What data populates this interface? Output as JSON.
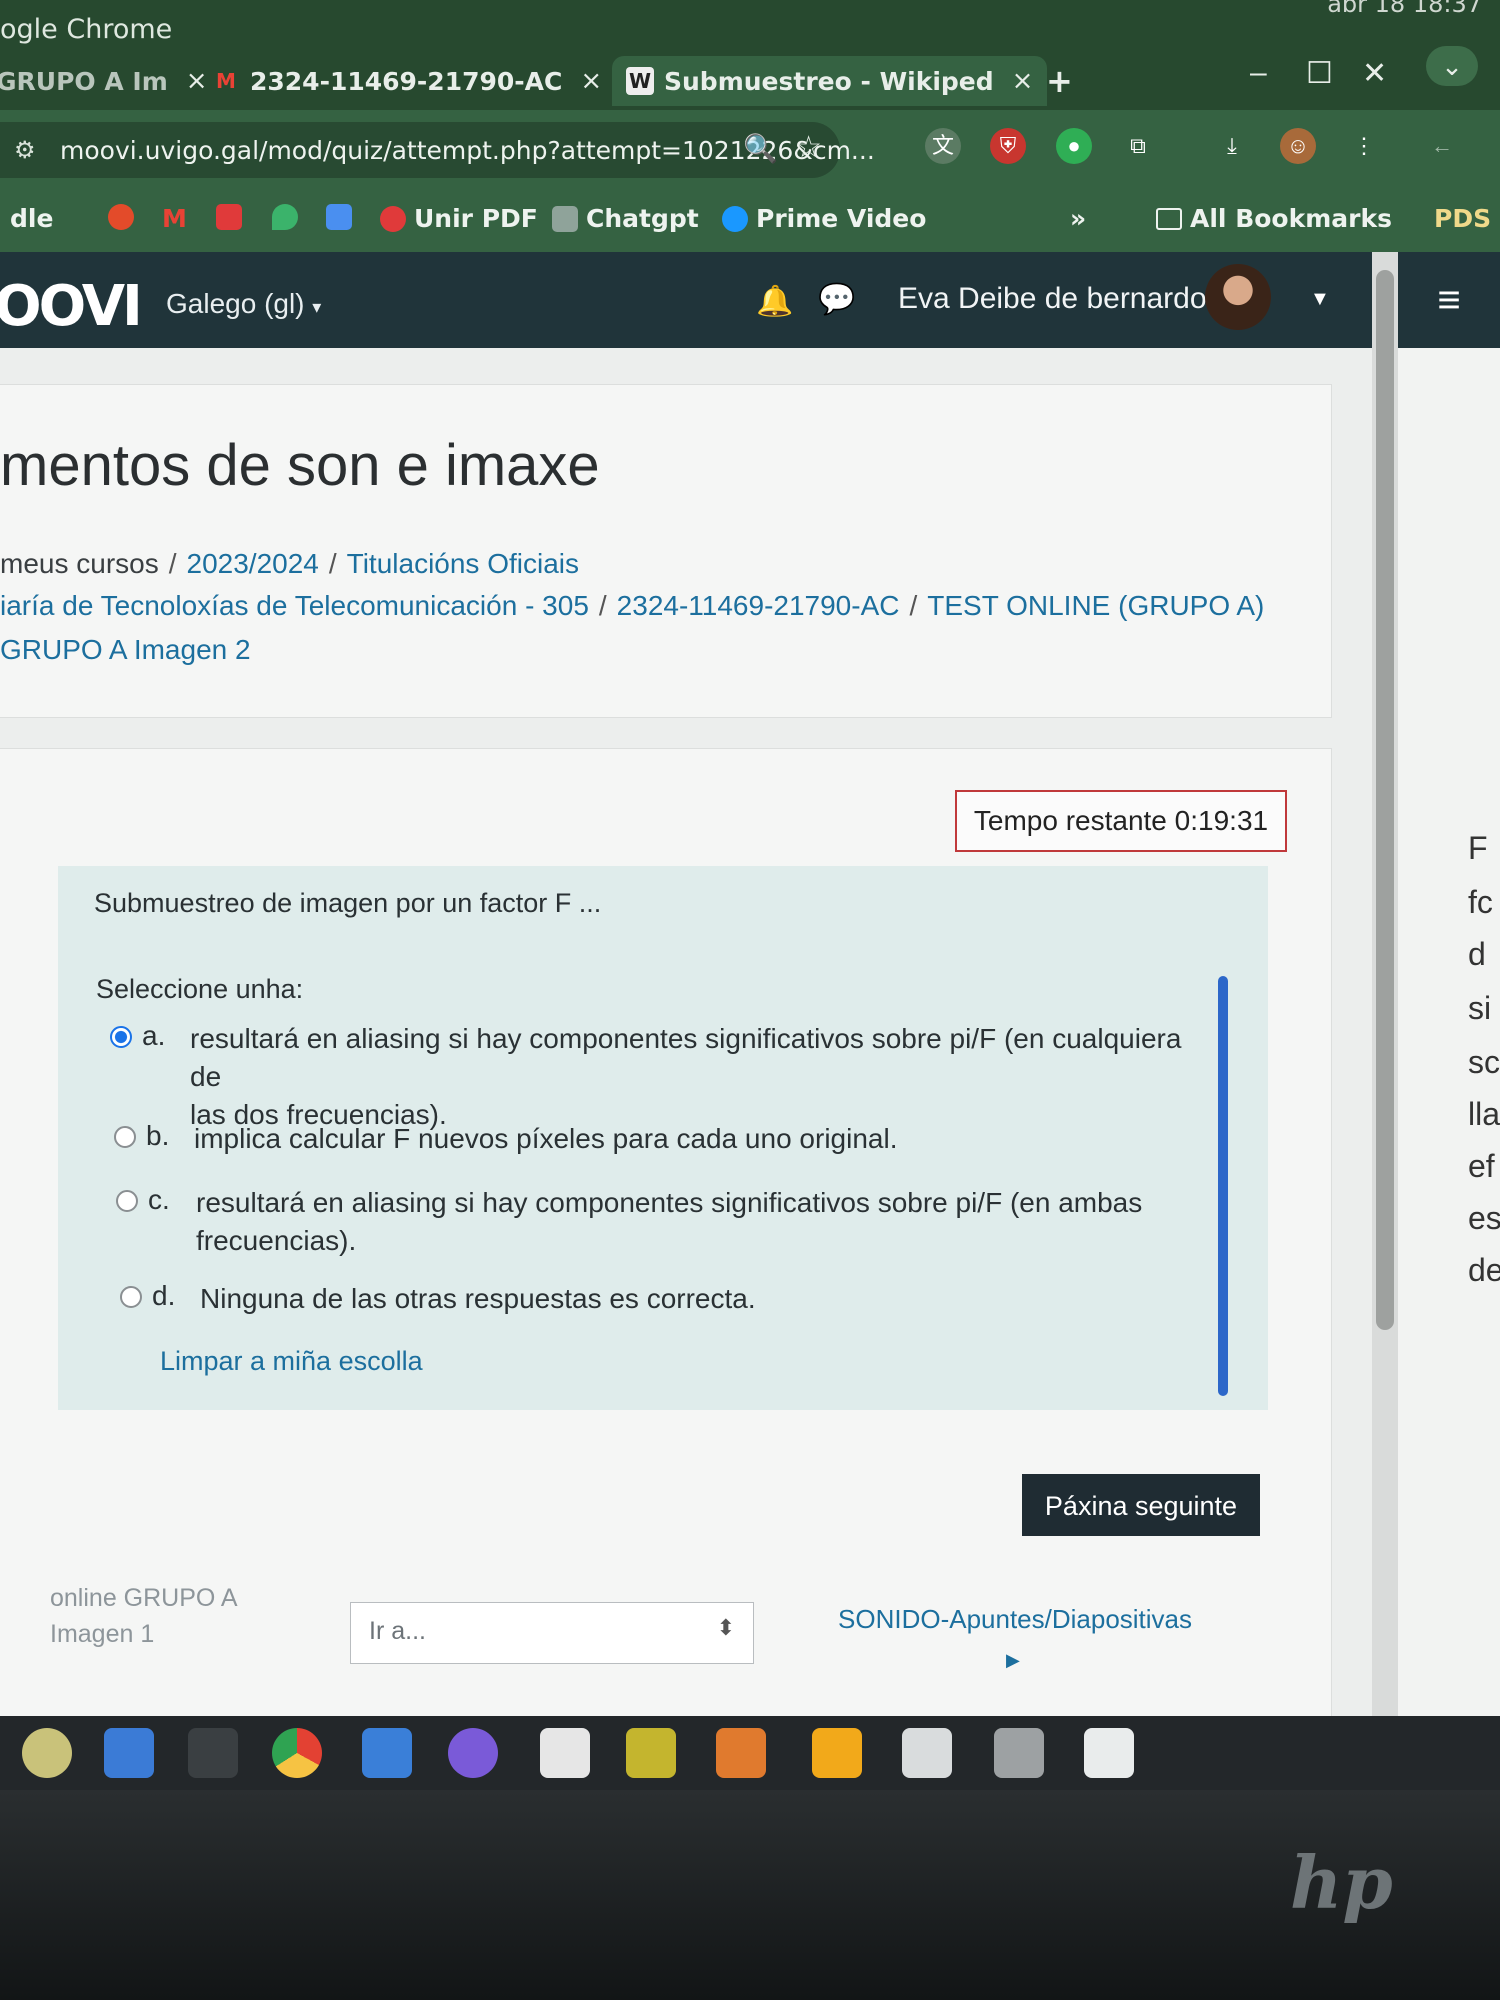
{
  "window": {
    "app_title": "ogle Chrome",
    "clock": "abr 18  18:37"
  },
  "tabs": [
    {
      "label": "GRUPO A Im",
      "close": "×"
    },
    {
      "label": "2324-11469-21790-AC",
      "close": "×",
      "favicon": "gmail-icon"
    },
    {
      "label": "Submuestreo - Wikiped",
      "close": "×",
      "favicon": "wikipedia-icon"
    }
  ],
  "new_tab": "+",
  "window_controls": {
    "minimize": "–",
    "maximize": "☐",
    "close": "✕",
    "menu": "⌄"
  },
  "address_bar": {
    "url": "moovi.uvigo.gal/mod/quiz/attempt.php?attempt=1021226&cm..."
  },
  "bookmarks": {
    "items": [
      "dle",
      "Unir PDF",
      "Chatgpt",
      "Prime Video"
    ],
    "more": "»",
    "all_bookmarks": "All Bookmarks",
    "pds": "PDS"
  },
  "navbar": {
    "logo": "OOVI",
    "language": "Galego (gl)",
    "user_name": "Eva Deibe de bernardo"
  },
  "course": {
    "title": "mentos de son e imaxe",
    "breadcrumb_line1": {
      "plain": "meus cursos",
      "links": [
        "2023/2024",
        "Titulacións Oficiais"
      ]
    },
    "breadcrumb_line2": [
      "iaría de Tecnoloxías de Telecomunicación - 305",
      "2324-11469-21790-AC",
      "TEST ONLINE (GRUPO A)"
    ],
    "breadcrumb_line3": "GRUPO A Imagen 2"
  },
  "quiz": {
    "timer": "Tempo restante 0:19:31",
    "question": "Submuestreo de imagen por un factor F ...",
    "prompt": "Seleccione unha:",
    "options": [
      {
        "letter": "a.",
        "line1": "resultará en aliasing si hay componentes significativos sobre pi/F (en cualquiera de",
        "line2": "las dos frecuencias).",
        "selected": true
      },
      {
        "letter": "b.",
        "line1": "implica calcular F nuevos píxeles para cada uno original.",
        "line2": "",
        "selected": false
      },
      {
        "letter": "c.",
        "line1": "resultará en aliasing si hay componentes significativos sobre pi/F (en ambas",
        "line2": "frecuencias).",
        "selected": false
      },
      {
        "letter": "d.",
        "line1": "Ninguna de las otras respuestas es correcta.",
        "line2": "",
        "selected": false
      }
    ],
    "clear_choice": "Limpar a miña escolla",
    "next_page": "Páxina seguinte"
  },
  "footer_nav": {
    "prev_line1": "online GRUPO A",
    "prev_line2": "Imagen 1",
    "jump_placeholder": "Ir a...",
    "next_link": "SONIDO-Apuntes/Diapositivas"
  },
  "right_pane_fragments": [
    "F",
    "fc",
    "d",
    "si",
    "sc",
    "lla",
    "ef",
    "es",
    "de"
  ],
  "laptop_brand": "hp"
}
